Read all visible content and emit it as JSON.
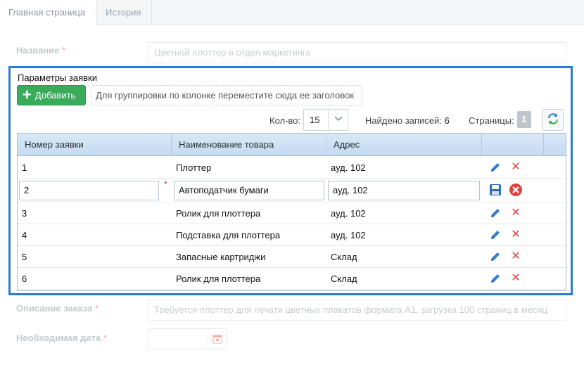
{
  "tabs": [
    {
      "label": "Главная страница",
      "active": true
    },
    {
      "label": "История",
      "active": false
    }
  ],
  "form": {
    "name_label": "Название",
    "name_value": "Цветной плоттер в отдел маркетинга",
    "description_label": "Описание заказа",
    "description_value": "Требуется плоттер для печати цветных плакатов формата А1, загрузка 100 страниц в месяц",
    "date_label": "Необходимая дата",
    "date_value": "",
    "required_mark": "*"
  },
  "panel": {
    "title": "Параметры заявки",
    "add_button_label": "Добавить",
    "group_hint": "Для группировки по колонке переместите сюда ее заголовок",
    "page_size_label": "Кол-во:",
    "page_size_value": "15",
    "records_label": "Найдено записей:",
    "records_value": "6",
    "pages_label": "Страницы:",
    "pages_value": "1"
  },
  "grid": {
    "columns": [
      "Номер заявки",
      "Наименование товара",
      "Адрес"
    ],
    "rows": [
      {
        "num": "1",
        "name": "Плоттер",
        "address": "ауд. 102",
        "editing": false
      },
      {
        "num": "2",
        "name": "Автоподатчик бумаги",
        "address": "ауд. 102",
        "editing": true
      },
      {
        "num": "3",
        "name": "Ролик для плоттера",
        "address": "ауд. 102",
        "editing": false
      },
      {
        "num": "4",
        "name": "Подставка для плоттера",
        "address": "ауд. 102",
        "editing": false
      },
      {
        "num": "5",
        "name": "Запасные картриджи",
        "address": "Склад",
        "editing": false
      },
      {
        "num": "6",
        "name": "Ролик для плоттера",
        "address": "Склад",
        "editing": false
      }
    ]
  },
  "icons": {
    "edit": "pencil-icon",
    "delete": "close-icon",
    "save": "floppy-disk-icon",
    "cancel": "cancel-circle-icon",
    "refresh": "refresh-icon",
    "calendar": "calendar-icon",
    "add": "plus-icon",
    "dropdown": "chevron-down-icon"
  },
  "colors": {
    "panel_border": "#2b7bd0",
    "add_button": "#3aab5a",
    "delete_red": "#e0413e",
    "edit_blue": "#2f7fd2",
    "header_blue": "#cde0f4"
  }
}
